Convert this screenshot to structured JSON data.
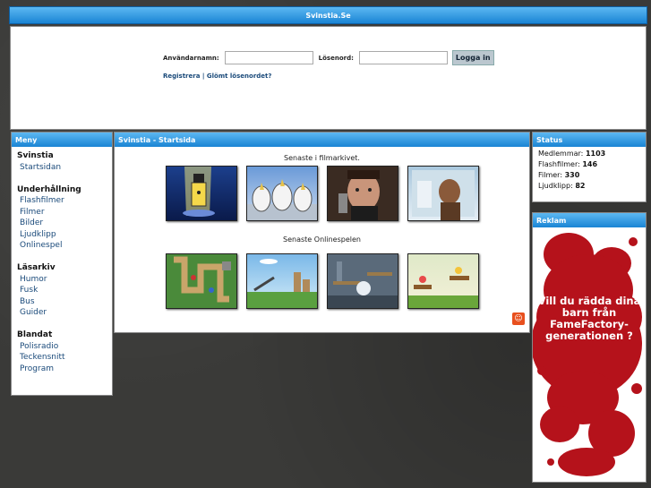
{
  "site": {
    "title": "Svinstia.Se"
  },
  "login": {
    "username_label": "Användarnamn:",
    "password_label": "Lösenord:",
    "button": "Logga in",
    "register": "Registrera",
    "separator": "|",
    "forgot": "Glömt lösenordet?"
  },
  "menu": {
    "header": "Meny",
    "sections": [
      {
        "title": "Svinstia",
        "items": [
          "Startsidan"
        ]
      },
      {
        "title": "Underhållning",
        "items": [
          "Flashfilmer",
          "Filmer",
          "Bilder",
          "Ljudklipp",
          "Onlinespel"
        ]
      },
      {
        "title": "Läsarkiv",
        "items": [
          "Humor",
          "Fusk",
          "Bus",
          "Guider"
        ]
      },
      {
        "title": "Blandat",
        "items": [
          "Polisradio",
          "Teckensnitt",
          "Program"
        ]
      }
    ]
  },
  "main": {
    "header": "Svinstia - Startsida",
    "films_caption": "Senaste i filmarkivet.",
    "games_caption": "Senaste Onlinespelen"
  },
  "status": {
    "header": "Status",
    "rows": [
      {
        "label": "Medlemmar:",
        "value": "1103"
      },
      {
        "label": "Flashfilmer:",
        "value": "146"
      },
      {
        "label": "Filmer:",
        "value": "330"
      },
      {
        "label": "Ljudklipp:",
        "value": "82"
      }
    ]
  },
  "ad": {
    "header": "Reklam",
    "text": "Vill du rädda dina barn från FameFactory-generationen ?"
  },
  "colors": {
    "header_blue": "#1a84d4",
    "link": "#1a4a7a",
    "ad_red": "#b5121b"
  },
  "icons": [
    "smiley-icon"
  ]
}
